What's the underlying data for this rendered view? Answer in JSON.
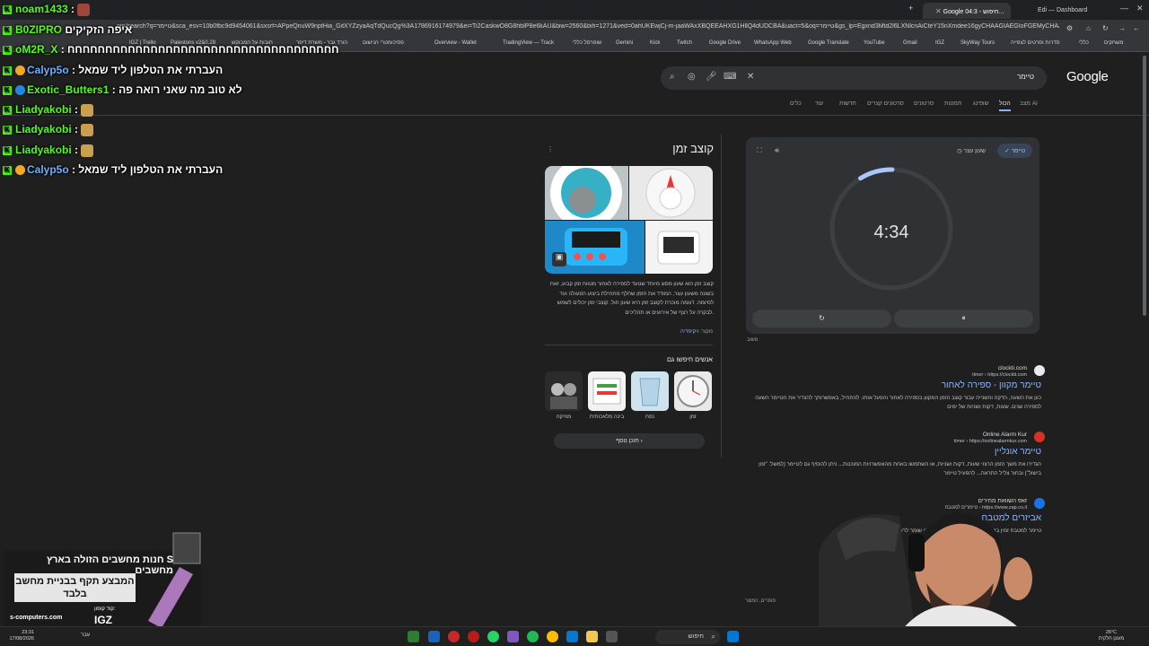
{
  "browser": {
    "tabs": [
      {
        "label": "Edi — Dashboard",
        "active": false
      },
      {
        "label": "Google חיפוש - 04:3...",
        "active": true
      }
    ],
    "url": "om/search?q=טיימר&sca_esv=10b0fbc9d9454061&sxsrf=APpeQnuW9nptHia_GitXYZzyaAqTdQucQg%3A1786916174979&ei=Ti2CaskwO8G8hbIP8e6kAU&biw=2560&bih=1271&ved=0ahUKEwjCj-m-jaaWAxXBQEEAHXG1HllQ4dUDCBA&uact=5&oq=טיימר&gs_lp=Egxnd3Mtd2l6LXNlcnAiCteY15nXmdee16gyCHAAGIAEGIoFGEMyCHAA",
    "bookmarks": [
      "IGZ | Trello",
      "Palestons v2&0.28",
      "חובות על המבוקש",
      "הורד גבר - משרת דיפר",
      "פסיכומטרי הנישום",
      "Overview - Wallet",
      "TradingView — Track",
      "שופרסל כללי",
      "Gemini",
      "Kick",
      "Twitch",
      "Google Drive",
      "WhatsApp Web",
      "Google Translate",
      "YouTube",
      "Gmail",
      "IGZ",
      "SkyWay Tours",
      "סדרות וסרטים לצפייה",
      "כללי",
      "משחקים"
    ]
  },
  "google": {
    "logo": "Google",
    "query": "טיימר",
    "tabs": [
      "מצב AI",
      "הכול",
      "שופינג",
      "תמונות",
      "סרטונים",
      "סרטונים קצרים",
      "חדשות",
      "עוד",
      "כלים"
    ],
    "active_tab": "הכול"
  },
  "timer": {
    "timer_label": "טיימר",
    "stopwatch_label": "שעון עצר",
    "time": "4:34",
    "reset_icon": "↻",
    "pause_icon": "⏸",
    "feedback": "משוב",
    "progress_fraction": 0.09
  },
  "results": [
    {
      "site": "clockti.com",
      "url": "timer › https://clockti.com",
      "title": "טיימר מקוון - ספירה לאחור",
      "snippet": "כוון את השעה, הדקה והשנייה עבור קוצב הזמן המקוון בספירה לאחור והפעל אותו. להתחיל, באפשרותך להגדיר את הטיימר השעה לספירה שנים. שעות, דקות ושניות של ימים"
    },
    {
      "site": "Online Alarm Kur",
      "url": "timer › https://onlinealarmkur.com",
      "title": "טיימר אונליין",
      "snippet": "הגדירו את משך הזמן הרצוי שעות, דקות ושניות, או השתמשו באחת מהאפשרויות המוכנות... ניתן להוסיף גם לטיימר (למשל: \"זמן בישול\") ובחור צליל התראה... להפעיל טיימר"
    },
    {
      "site": "זאפ השוואת מחירים",
      "url": "טיימרים למטבח › https://www.zap.co.il",
      "title": "אביזרים למטבח",
      "snippet": "טיימר למטבח זמין במגוון... תוכלו לבחור לפי צבע לתו שומר לרשום בהערות מבית"
    }
  ],
  "result_meta": "סופרים, המוצר",
  "knowledge_panel": {
    "title": "קוצב זמן",
    "description": "קוצב זמן הוא שעון מסוג מיוחד שנועד לספירה לאחור מטווח זמן קבוע, זאת בשונה משעון עצר, המודד את הזמן שחלף מתחילת ביצוע הפעולה ועד לסיומה. דוגמה מוכרת לקוצב זמן היא שעון חול. קוצבי זמן יכולים לשמש לבקרה על רצף של אירועים או תהליכים.",
    "source_label": "מקור:",
    "source_link": "ויקיפדיה",
    "people_also_search": "אנשים חיפשו גם",
    "related": [
      {
        "label": "זמן",
        "icon": "clock-icon"
      },
      {
        "label": "נפח",
        "icon": "cup-icon"
      },
      {
        "label": "בינה מלאכותית",
        "icon": "notebook-icon"
      },
      {
        "label": "מוזיקה",
        "icon": "music-icon"
      }
    ],
    "feedback_btn": "תוכן נוסף"
  },
  "chat": [
    {
      "user": "noam1433",
      "msg": ":",
      "color": "green"
    },
    {
      "user": "B0ZIPRO",
      "msg": "איפה הזקיקים",
      "color": "green"
    },
    {
      "user": "oM2R_X",
      "msg": ": חחחחחחחחחחחחחחחחחחחחחחחחחחחחחחחחחחחח",
      "color": "green"
    },
    {
      "user": "Calyp5o",
      "msg": ": העברתי את הטלפון ליד שמאל",
      "color": "blue"
    },
    {
      "user": "Exotic_Butters1",
      "msg": ": לא טוב מה שאני רואה פה",
      "color": "green"
    },
    {
      "user": "Liadyakobi",
      "msg": ":",
      "color": "green"
    },
    {
      "user": "Liadyakobi",
      "msg": ":",
      "color": "green"
    },
    {
      "user": "Liadyakobi",
      "msg": ":",
      "color": "green"
    },
    {
      "user": "Calyp5o",
      "msg": ": העברתי את הטלפון ליד שמאל",
      "color": "blue"
    }
  ],
  "ad": {
    "title": "חנות מחשבים הזולה בארץ S מחשבים",
    "box": "המבצע תקף בבניית מחשב בלבד",
    "site": "s-computers.com",
    "code_label": "קוד קופון:",
    "code": "IGZ"
  },
  "taskbar": {
    "search": "חיפוש",
    "clock_time": "23:31",
    "clock_date": "17/08/2026",
    "lang": "עבר",
    "weather_temp": "26°C",
    "weather_desc": "מעונן חלקית"
  }
}
